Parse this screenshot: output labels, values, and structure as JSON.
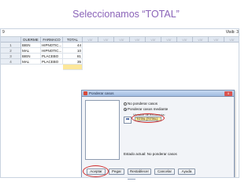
{
  "slide": {
    "title": "Seleccionamos “TOTAL”"
  },
  "topbar": {
    "cell_ref": "9",
    "visible": "Visib: 3"
  },
  "grid": {
    "columns": [
      "DUERME",
      "FARMACO",
      "TOTAL",
      "var",
      "var",
      "var",
      "var",
      "var",
      "var",
      "var",
      "var",
      "var",
      "var"
    ],
    "rows": [
      {
        "num": "1",
        "duerme": "BIEN",
        "farmaco": "HIPNOTIC...",
        "total": "44"
      },
      {
        "num": "2",
        "duerme": "MAL",
        "farmaco": "HIPNOTIC...",
        "total": "10"
      },
      {
        "num": "3",
        "duerme": "BIEN",
        "farmaco": "PLACEBO",
        "total": "81"
      },
      {
        "num": "4",
        "duerme": "MAL",
        "farmaco": "PLACEBO",
        "total": "35"
      }
    ]
  },
  "dialog": {
    "title": "Ponderar casos",
    "close_label": "x",
    "radio_options": [
      "No ponderar casos",
      "Ponderar casos mediante"
    ],
    "frequency_label": "Variable de frecuencia:",
    "frequency_value": "TOTAL [TOTAL]",
    "move_arrow": "➡",
    "status_text": "Estado actual: No ponderar casos",
    "buttons": [
      "Aceptar",
      "Pegar",
      "Restablecer",
      "Cancelar",
      "Ayuda"
    ]
  },
  "colors": {
    "title": "#8a63b8",
    "highlight": "#fde79a",
    "annotation": "#d12c2c",
    "titlebar": "#9fbbe0"
  }
}
